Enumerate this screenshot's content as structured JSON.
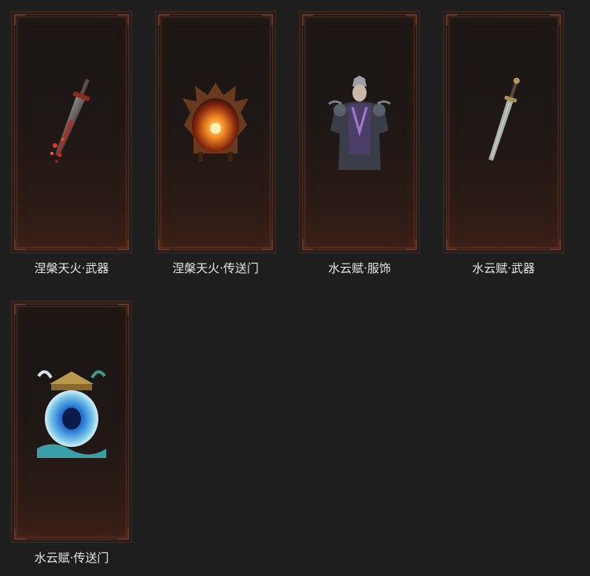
{
  "items": [
    {
      "label": "涅槃天火·武器",
      "icon": "flame-sword-icon"
    },
    {
      "label": "涅槃天火·传送门",
      "icon": "flame-portal-icon"
    },
    {
      "label": "水云赋·服饰",
      "icon": "armor-costume-icon"
    },
    {
      "label": "水云赋·武器",
      "icon": "sword-icon"
    },
    {
      "label": "水云赋·传送门",
      "icon": "water-portal-icon"
    }
  ],
  "colors": {
    "background": "#1e1e1e",
    "label": "#e6e6e6",
    "frame": "#4a2c22"
  }
}
